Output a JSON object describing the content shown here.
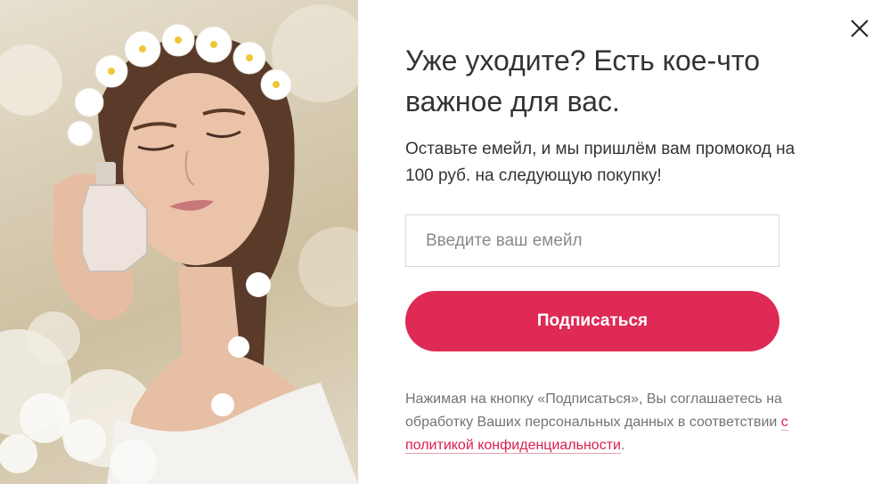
{
  "close": {
    "icon": "close-icon"
  },
  "image": {
    "subject": "woman-with-flower-wreath-perfume-photo"
  },
  "headline": "Уже уходите? Есть кое-что важное для вас.",
  "subtext": "Оставьте емейл, и мы пришлём вам промокод на 100 руб. на следующую покупку!",
  "form": {
    "email_placeholder": "Введите ваш емейл",
    "email_value": "",
    "submit_label": "Подписаться"
  },
  "legal": {
    "text": "Нажимая на кнопку «Подписаться», Вы соглашаетесь на обработку Ваших персональных данных в соответствии ",
    "link_label": "с политикой конфиденциальности",
    "suffix": "."
  },
  "colors": {
    "accent": "#de2a55",
    "link": "#d81f4b",
    "text": "#333333",
    "muted": "#737373"
  }
}
